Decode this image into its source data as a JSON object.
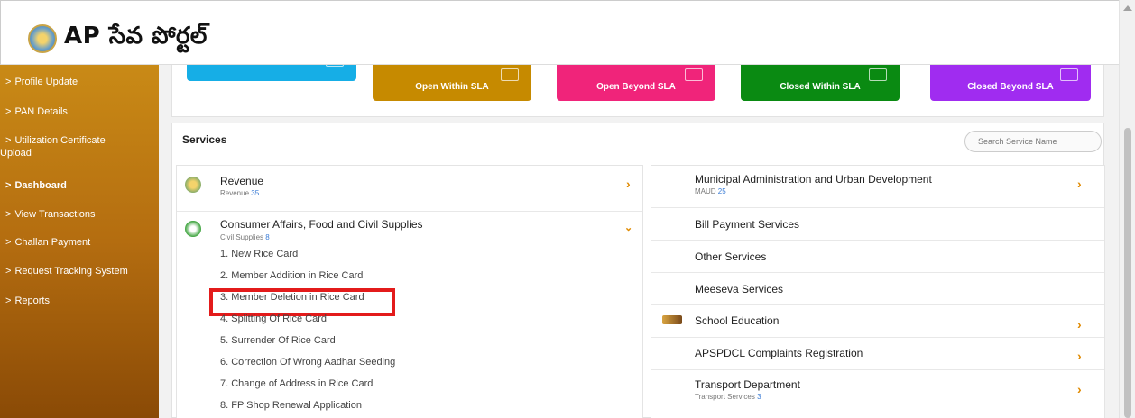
{
  "header": {
    "logo_text": "AP సేవ పోర్టల్"
  },
  "sidebar": {
    "items": [
      {
        "label": "Profile Update"
      },
      {
        "label": "PAN Details"
      },
      {
        "label": "Utilization Certificate",
        "label2": "Upload"
      },
      {
        "label": "Dashboard"
      },
      {
        "label": "View Transactions"
      },
      {
        "label": "Challan Payment"
      },
      {
        "label": "Request Tracking System"
      },
      {
        "label": "Reports"
      }
    ]
  },
  "status_cards": [
    {
      "label": "Open Within SLA",
      "color": "#c68a00"
    },
    {
      "label": "Open Beyond SLA",
      "color": "#f0247a"
    },
    {
      "label": "Closed Within SLA",
      "color": "#0a8a12"
    },
    {
      "label": "Closed Beyond SLA",
      "color": "#a02cf0"
    }
  ],
  "services": {
    "title": "Services",
    "search_placeholder": "Search Service Name",
    "left": [
      {
        "title": "Revenue",
        "sub": "Revenue",
        "count": "35"
      },
      {
        "title": "Consumer Affairs, Food and Civil Supplies",
        "sub": "Civil Supplies",
        "count": "8",
        "items": [
          "1. New Rice Card",
          "2. Member Addition in Rice Card",
          "3. Member Deletion in Rice Card",
          "4. Splitting Of Rice Card",
          "5. Surrender Of Rice Card",
          "6. Correction Of Wrong Aadhar Seeding",
          "7. Change of Address in Rice Card",
          "8. FP Shop Renewal Application"
        ]
      }
    ],
    "right": [
      {
        "title": "Municipal Administration and Urban Development",
        "sub": "MAUD",
        "count": "25"
      },
      {
        "title": "Bill Payment Services"
      },
      {
        "title": "Other Services"
      },
      {
        "title": "Meeseva Services"
      },
      {
        "title": "School Education"
      },
      {
        "title": "APSPDCL Complaints Registration"
      },
      {
        "title": "Transport Department",
        "sub": "Transport Services",
        "count": "3"
      }
    ]
  }
}
